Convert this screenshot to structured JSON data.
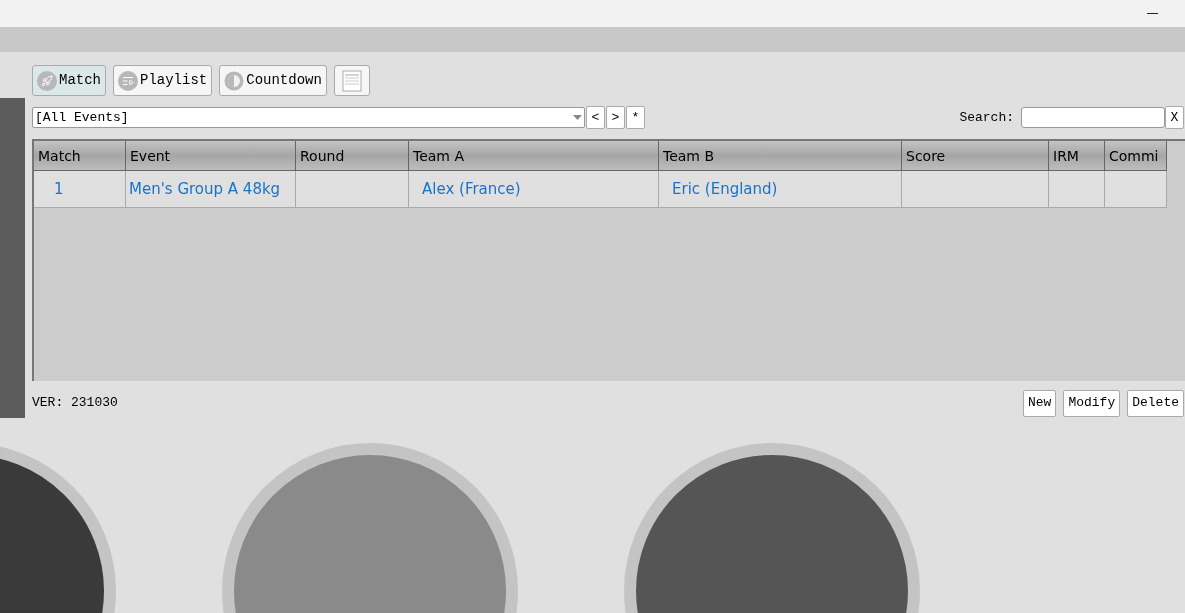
{
  "toolbar": [
    {
      "kind": "rocket",
      "label": "Match",
      "selected": true
    },
    {
      "kind": "playlist",
      "label": "Playlist",
      "selected": false
    },
    {
      "kind": "timer",
      "label": "Countdown",
      "selected": false
    },
    {
      "kind": "document",
      "selected": false
    }
  ],
  "filter": {
    "value": "[All Events]",
    "nav": [
      "<",
      ">",
      "*"
    ]
  },
  "search": {
    "label": "Search:",
    "clear": "X"
  },
  "table": {
    "columns": [
      "Match",
      "Event",
      "Round",
      "Team A",
      "Team B",
      "Score",
      "IRM",
      "Commi"
    ],
    "rows": [
      {
        "match": "1",
        "event": "Men's Group A 48kg",
        "team_a": "Alex (France)",
        "team_b": "Eric (England)"
      }
    ]
  },
  "version": "VER: 231030",
  "actions": [
    "New",
    "Modify",
    "Delete"
  ]
}
